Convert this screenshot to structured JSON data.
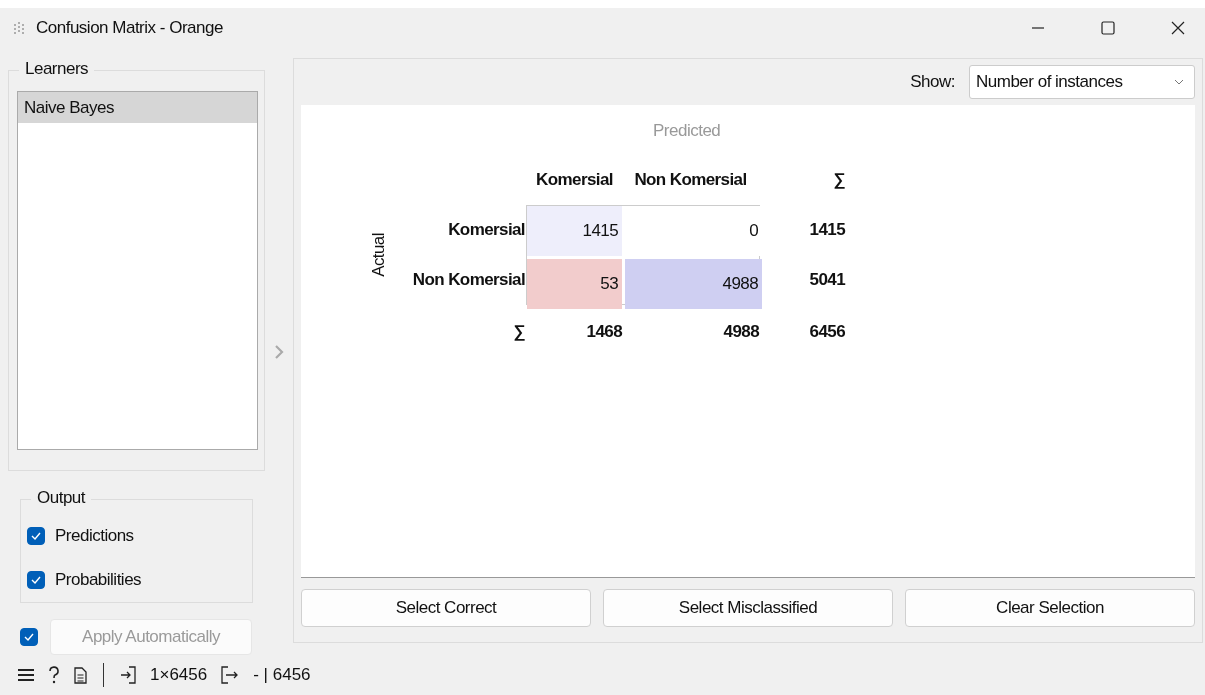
{
  "window": {
    "title": "Confusion Matrix - Orange"
  },
  "learners": {
    "title": "Learners",
    "items": [
      {
        "label": "Naive Bayes",
        "selected": true
      }
    ]
  },
  "output": {
    "title": "Output",
    "options": [
      {
        "label": "Predictions",
        "checked": true
      },
      {
        "label": "Probabilities",
        "checked": true
      }
    ]
  },
  "auto_apply": {
    "checked": true,
    "label": "Apply Automatically",
    "disabled": true
  },
  "show": {
    "label": "Show:",
    "value": "Number of instances"
  },
  "matrix": {
    "predicted_label": "Predicted",
    "actual_label": "Actual",
    "columns": [
      "Komersial",
      "Non Komersial"
    ],
    "sum_column_symbol": "∑",
    "rows": [
      {
        "label": "Komersial",
        "cells": [
          {
            "value": "1415",
            "color": "#eeeefb"
          },
          {
            "value": "0",
            "color": "#ffffff"
          }
        ],
        "total": "1415"
      },
      {
        "label": "Non Komersial",
        "cells": [
          {
            "value": "53",
            "color": "#f2cccc"
          },
          {
            "value": "4988",
            "color": "#cfcff2"
          }
        ],
        "total": "5041"
      }
    ],
    "sum_row_symbol": "∑",
    "column_totals": [
      "1468",
      "4988"
    ],
    "grand_total": "6456"
  },
  "buttons": [
    "Select Correct",
    "Select Misclassified",
    "Clear Selection"
  ],
  "status_bar": {
    "input": "1×6456",
    "output": "- | 6456"
  }
}
